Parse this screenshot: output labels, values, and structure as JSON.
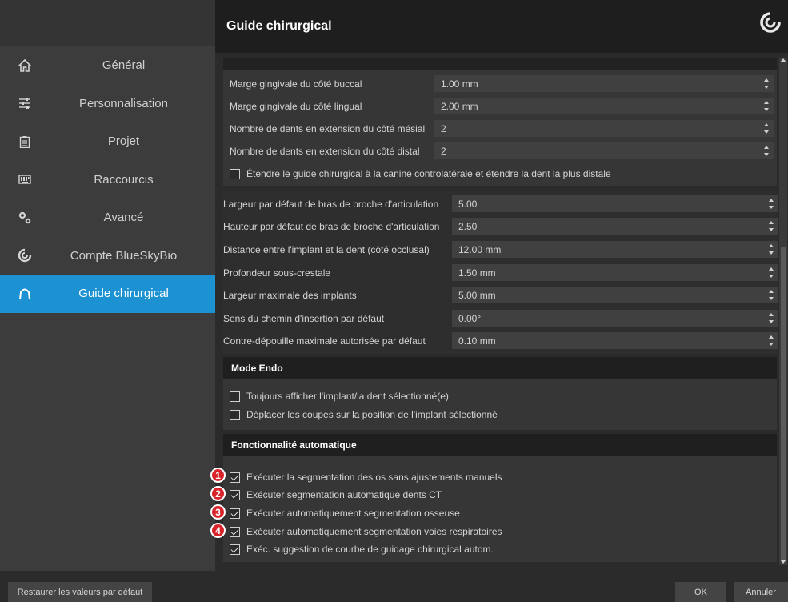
{
  "header": {
    "title": "Guide chirurgical",
    "logo_icon": "bluesky-swirl-icon"
  },
  "sidebar": {
    "items": [
      {
        "label": "Général",
        "icon": "home-icon"
      },
      {
        "label": "Personnalisation",
        "icon": "sliders-icon"
      },
      {
        "label": "Projet",
        "icon": "clipboard-icon"
      },
      {
        "label": "Raccourcis",
        "icon": "keyboard-icon"
      },
      {
        "label": "Avancé",
        "icon": "gears-icon"
      },
      {
        "label": "Compte BlueSkyBio",
        "icon": "bluesky-swirl-icon"
      },
      {
        "label": "Guide chirurgical",
        "icon": "arch-icon",
        "active": true
      }
    ],
    "accent_color": "#1d92d3"
  },
  "group1": {
    "fields": [
      {
        "label": "Marge gingivale du côté buccal",
        "value": "1.00 mm"
      },
      {
        "label": "Marge gingivale du côté lingual",
        "value": "2.00 mm"
      },
      {
        "label": "Nombre de dents en extension du côté mésial",
        "value": "2"
      },
      {
        "label": "Nombre de dents en extension du côté distal",
        "value": "2"
      }
    ],
    "checkbox": {
      "label": "Étendre le guide chirurgical à la canine controlatérale et étendre la dent la plus distale",
      "checked": false
    }
  },
  "group2": {
    "fields": [
      {
        "label": "Largeur par défaut de bras de broche d'articulation",
        "value": "5.00"
      },
      {
        "label": "Hauteur par défaut de bras de broche d'articulation",
        "value": "2.50"
      },
      {
        "label": "Distance entre l'implant et la dent (côté occlusal)",
        "value": "12.00 mm"
      },
      {
        "label": "Profondeur sous-crestale",
        "value": "1.50 mm"
      },
      {
        "label": "Largeur maximale des implants",
        "value": "5.00 mm"
      },
      {
        "label": "Sens du chemin d'insertion par défaut",
        "value": "0.00°"
      },
      {
        "label": "Contre-dépouille maximale autorisée par défaut",
        "value": "0.10 mm"
      }
    ]
  },
  "endo": {
    "title": "Mode Endo",
    "options": [
      {
        "label": "Toujours afficher l'implant/la dent sélectionné(e)",
        "checked": false
      },
      {
        "label": "Déplacer les coupes sur la position de l'implant sélectionné",
        "checked": false
      }
    ]
  },
  "auto": {
    "title": "Fonctionnalité automatique",
    "options": [
      {
        "label": "Exécuter la segmentation des os sans ajustements manuels",
        "checked": true,
        "badge": "1"
      },
      {
        "label": "Exécuter segmentation automatique dents CT",
        "checked": true,
        "badge": "2"
      },
      {
        "label": "Exécuter automatiquement segmentation osseuse",
        "checked": true,
        "badge": "3"
      },
      {
        "label": "Exécuter automatiquement segmentation voies respiratoires",
        "checked": true,
        "badge": "4"
      },
      {
        "label": "Exéc. suggestion de courbe de guidage chirurgical autom.",
        "checked": true,
        "badge": ""
      }
    ],
    "badge_color": "#d8232a"
  },
  "footer": {
    "restore_label": "Restaurer les valeurs par défaut",
    "ok_label": "OK",
    "cancel_label": "Annuler"
  }
}
